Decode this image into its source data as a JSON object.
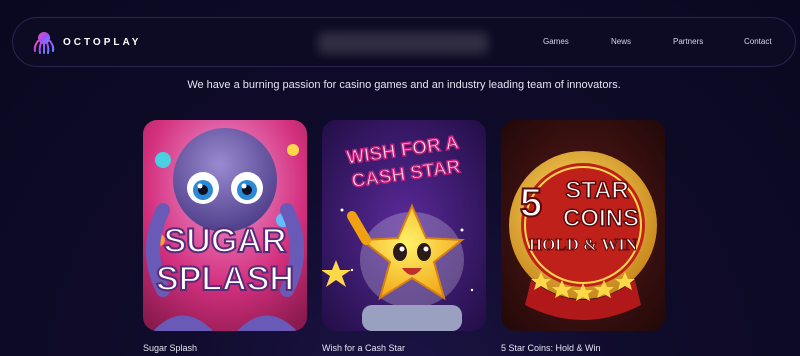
{
  "header": {
    "logo_text": "OCTOPLAY",
    "nav": [
      "Games",
      "News",
      "Partners",
      "Contact"
    ]
  },
  "tagline": "We have a burning passion for casino games and an industry leading team of innovators.",
  "games": [
    {
      "title": "Sugar Splash",
      "art_lines": [
        "SUGAR",
        "SPLASH"
      ]
    },
    {
      "title": "Wish for a Cash Star",
      "art_lines": [
        "WISH FOR A",
        "CASH STAR"
      ]
    },
    {
      "title": "5 Star Coins: Hold & Win",
      "art_lines": [
        "5",
        "STAR",
        "COINS",
        "HOLD & WIN"
      ]
    }
  ],
  "colors": {
    "background": "#0f0b2a",
    "accent_purple": "#8b3ce0",
    "accent_pink": "#e0307a"
  }
}
